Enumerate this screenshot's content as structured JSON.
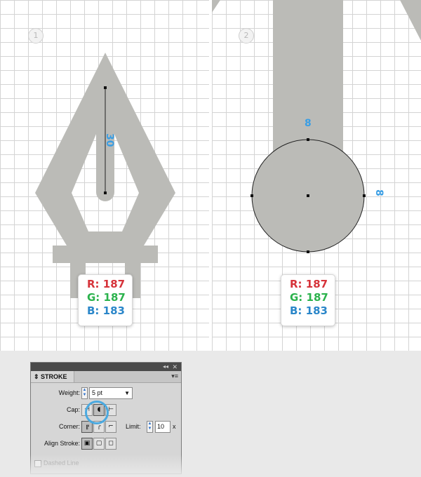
{
  "steps": [
    {
      "number": "1",
      "dimension_label": "30",
      "rgb": {
        "r": "R: 187",
        "g": "G: 187",
        "b": "B: 183"
      }
    },
    {
      "number": "2",
      "dimension_label_top": "8",
      "dimension_label_right": "8",
      "rgb": {
        "r": "R: 187",
        "g": "G: 187",
        "b": "B: 183"
      }
    }
  ],
  "colors": {
    "shape_fill": "#bbbbb7",
    "grid_line": "#d4d4d4",
    "dimension_label": "#3a9ee4",
    "highlight_ring": "#4aa9e0"
  },
  "stroke_panel": {
    "tab_label": "STROKE",
    "collapse_icon": "double-arrow-left-icon",
    "close_label": "✕",
    "menu_label": "▾≡",
    "weight_label": "Weight:",
    "weight_value": "5 pt",
    "cap_label": "Cap:",
    "cap_options": [
      "butt-cap",
      "round-cap",
      "projecting-cap"
    ],
    "cap_selected": "round-cap",
    "corner_label": "Corner:",
    "corner_options": [
      "miter-join",
      "round-join",
      "bevel-join"
    ],
    "corner_selected": "miter-join",
    "limit_label": "Limit:",
    "limit_value": "10",
    "limit_unit": "x",
    "align_label": "Align Stroke:",
    "align_options": [
      "align-center",
      "align-inside",
      "align-outside"
    ],
    "align_selected": "align-center",
    "dashed_line_label": "Dashed Line"
  }
}
